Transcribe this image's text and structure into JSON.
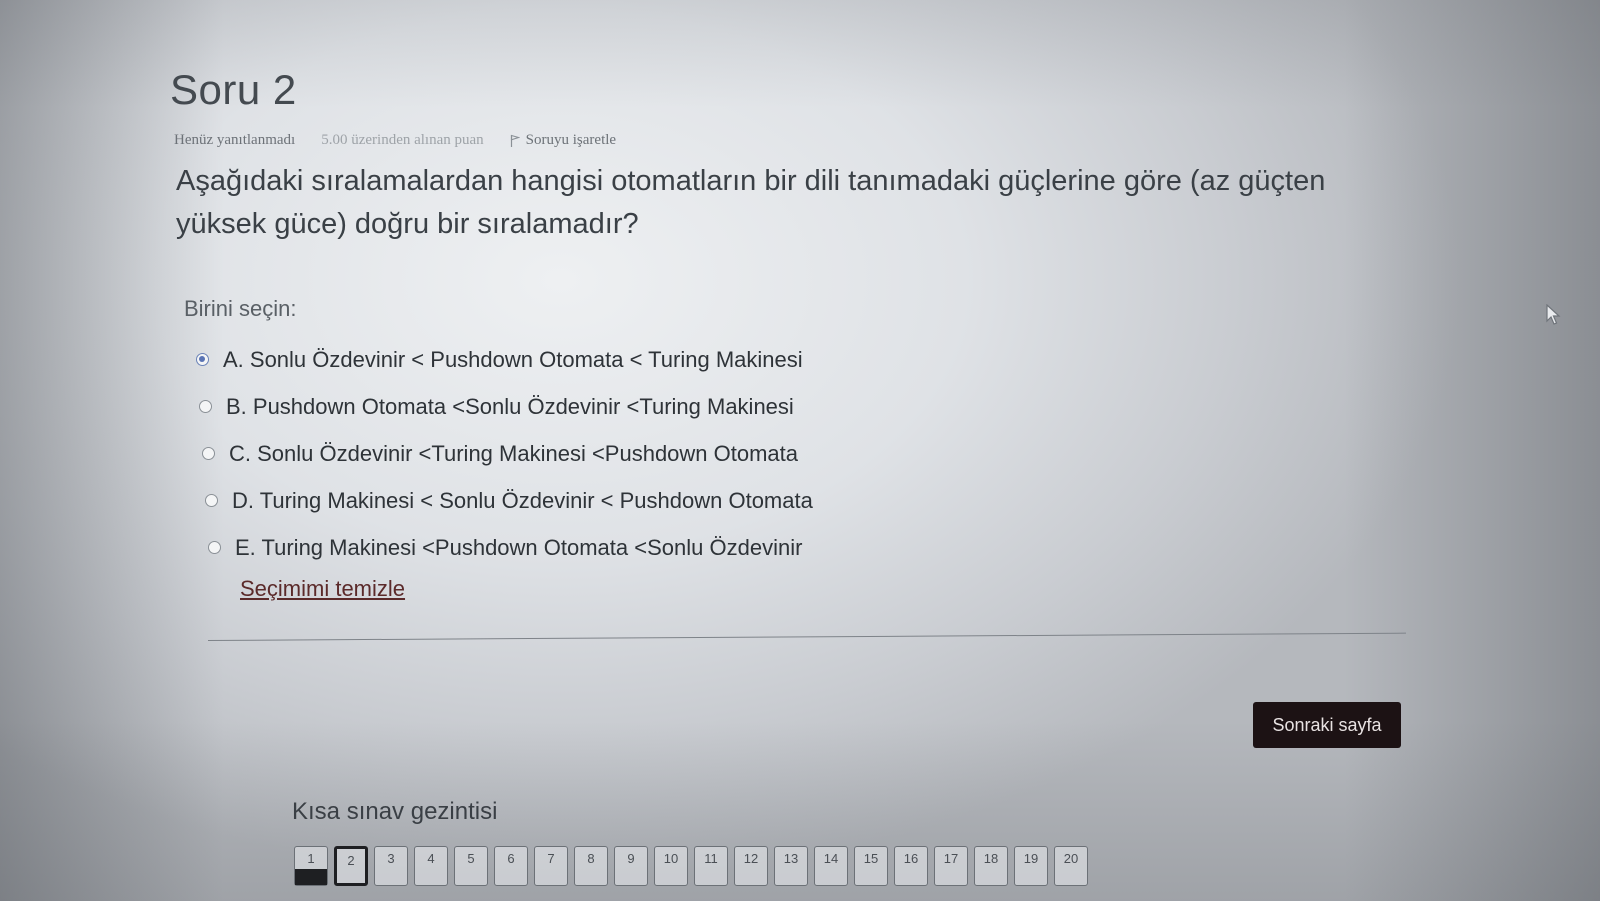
{
  "question": {
    "title": "Soru 2",
    "status": "Henüz yanıtlanmadı",
    "points": "5.00 üzerinden alınan puan",
    "flag_label": "Soruyu işaretle",
    "text": "Aşağıdaki sıralamalardan hangisi otomatların bir dili tanımadaki güçlerine göre (az güçten yüksek güce) doğru bir sıralamadır?",
    "select_label": "Birini seçin:",
    "options": [
      {
        "label": "A. Sonlu Özdevinir < Pushdown Otomata < Turing Makinesi",
        "selected": true
      },
      {
        "label": "B. Pushdown Otomata <Sonlu Özdevinir <Turing Makinesi",
        "selected": false
      },
      {
        "label": "C. Sonlu Özdevinir <Turing Makinesi <Pushdown Otomata",
        "selected": false
      },
      {
        "label": "D. Turing Makinesi < Sonlu Özdevinir < Pushdown Otomata",
        "selected": false
      },
      {
        "label": "E. Turing Makinesi <Pushdown Otomata <Sonlu Özdevinir",
        "selected": false
      }
    ],
    "clear_label": "Seçimimi temizle"
  },
  "next_button_label": "Sonraki sayfa",
  "quiz_nav": {
    "title": "Kısa sınav gezintisi",
    "current": 2,
    "answered": [
      1
    ],
    "pages": [
      "1",
      "2",
      "3",
      "4",
      "5",
      "6",
      "7",
      "8",
      "9",
      "10",
      "11",
      "12",
      "13",
      "14",
      "15",
      "16",
      "17",
      "18",
      "19",
      "20"
    ]
  },
  "colors": {
    "selected_radio": "#5a74b4",
    "next_button_bg": "#1c1214",
    "clear_link": "#5b2a2a"
  },
  "icons": {
    "flag": "flag-icon",
    "cursor": "mouse-pointer-icon"
  }
}
